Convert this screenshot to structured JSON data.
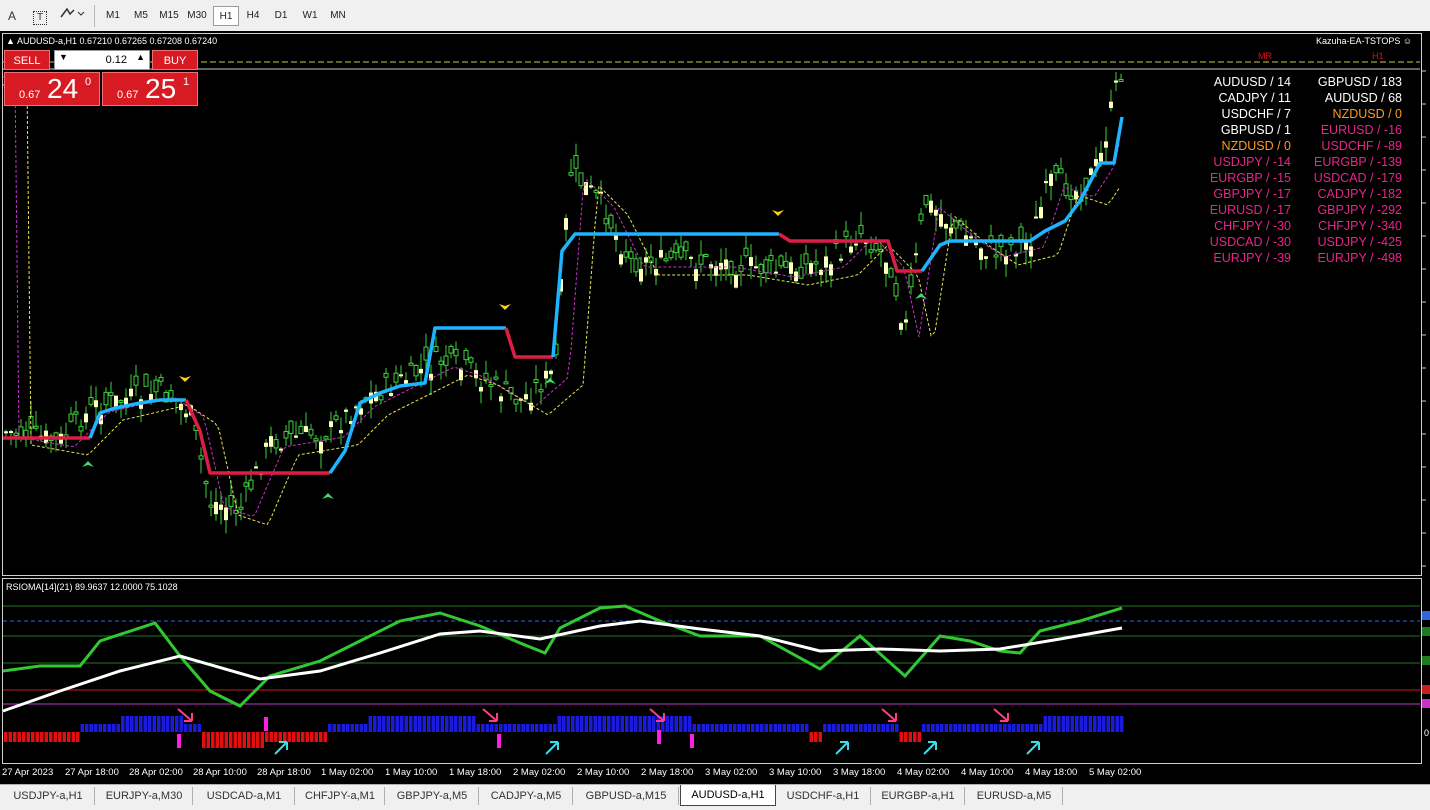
{
  "toolbar": {
    "icons": [
      "text-a-icon",
      "text-box-icon",
      "objects-dropdown-icon"
    ],
    "a_label": "A",
    "t_label": "T",
    "timeframes": [
      "M1",
      "M5",
      "M15",
      "M30",
      "H1",
      "H4",
      "D1",
      "W1",
      "MN"
    ],
    "active_timeframe": "H1"
  },
  "chart": {
    "symbol_info": "AUDUSD-a,H1  0.67210 0.67265 0.67208 0.67240",
    "ea_name": "Kazuha-EA-TSTOPS",
    "smiley": "☺",
    "level_labels": [
      "MR",
      "H1"
    ],
    "trade": {
      "sell_label": "SELL",
      "buy_label": "BUY",
      "lot": "0.12",
      "sell_prefix": "0.67",
      "sell_big": "24",
      "sell_sup": "0",
      "buy_prefix": "0.67",
      "buy_big": "25",
      "buy_sup": "1"
    },
    "strength_left": [
      {
        "text": "AUDUSD / 14",
        "color": "#ffffff"
      },
      {
        "text": "CADJPY / 11",
        "color": "#ffffff"
      },
      {
        "text": "USDCHF / 7",
        "color": "#ffffff"
      },
      {
        "text": "GBPUSD / 1",
        "color": "#ffffff"
      },
      {
        "text": "NZDUSD / 0",
        "color": "#ff9a1a"
      },
      {
        "text": "USDJPY / -14",
        "color": "#e8258a"
      },
      {
        "text": "EURGBP / -15",
        "color": "#e8258a"
      },
      {
        "text": "GBPJPY / -17",
        "color": "#e8258a"
      },
      {
        "text": "EURUSD / -17",
        "color": "#e8258a"
      },
      {
        "text": "CHFJPY / -30",
        "color": "#e8258a"
      },
      {
        "text": "USDCAD / -30",
        "color": "#e8258a"
      },
      {
        "text": "EURJPY / -39",
        "color": "#e8258a"
      }
    ],
    "strength_right": [
      {
        "text": "GBPUSD / 183",
        "color": "#ffffff"
      },
      {
        "text": "AUDUSD / 68",
        "color": "#ffffff"
      },
      {
        "text": "NZDUSD / 0",
        "color": "#ff9a1a"
      },
      {
        "text": "EURUSD / -16",
        "color": "#e8258a"
      },
      {
        "text": "USDCHF / -89",
        "color": "#e8258a"
      },
      {
        "text": "EURGBP / -139",
        "color": "#e8258a"
      },
      {
        "text": "USDCAD / -179",
        "color": "#e8258a"
      },
      {
        "text": "CADJPY / -182",
        "color": "#e8258a"
      },
      {
        "text": "GBPJPY / -292",
        "color": "#e8258a"
      },
      {
        "text": "CHFJPY / -340",
        "color": "#e8258a"
      },
      {
        "text": "USDJPY / -425",
        "color": "#e8258a"
      },
      {
        "text": "EURJPY / -498",
        "color": "#e8258a"
      }
    ],
    "indicator_label": "RSIOMA[14](21) 89.9637 12.0000 75.1028",
    "indicator_zero": "0",
    "x_axis": [
      "27 Apr 2023",
      "27 Apr 18:00",
      "28 Apr 02:00",
      "28 Apr 10:00",
      "28 Apr 18:00",
      "1 May 02:00",
      "1 May 10:00",
      "1 May 18:00",
      "2 May 02:00",
      "2 May 10:00",
      "2 May 18:00",
      "3 May 02:00",
      "3 May 10:00",
      "3 May 18:00",
      "4 May 02:00",
      "4 May 10:00",
      "4 May 18:00",
      "5 May 02:00"
    ],
    "colors": {
      "bull_candle": "#ffffc0",
      "wick": "#3cd23c",
      "trail_up": "#1eb4ff",
      "trail_down": "#dc1e46",
      "rsi": "#32c832",
      "rsi_signal": "#ffffff",
      "hist_up": "#1a1adc",
      "hist_down": "#e01010"
    }
  },
  "tabs": {
    "items": [
      "USDJPY-a,H1",
      "EURJPY-a,M30",
      "USDCAD-a,M1",
      "CHFJPY-a,M1",
      "GBPJPY-a,M5",
      "CADJPY-a,M5",
      "GBPUSD-a,M15",
      "AUDUSD-a,H1",
      "USDCHF-a,H1",
      "EURGBP-a,H1",
      "EURUSD-a,M5"
    ],
    "active": "AUDUSD-a,H1"
  }
}
